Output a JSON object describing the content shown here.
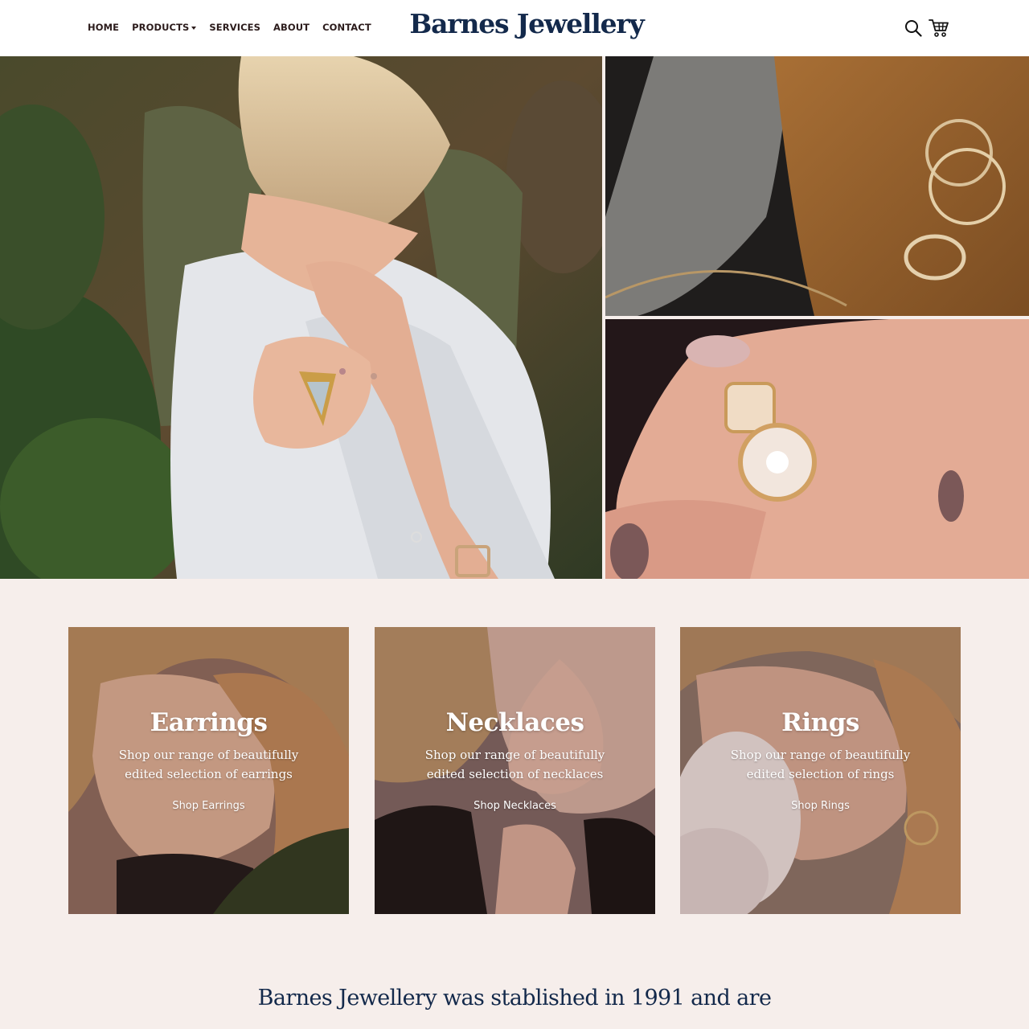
{
  "brand": {
    "name": "Barnes Jewellery",
    "color": "#13294b"
  },
  "nav": {
    "items": [
      {
        "label": "HOME"
      },
      {
        "label": "PRODUCTS"
      },
      {
        "label": "SERVICES"
      },
      {
        "label": "ABOUT"
      },
      {
        "label": "CONTACT"
      }
    ]
  },
  "header_icons": {
    "search": "search-icon",
    "cart": "cart-icon"
  },
  "hero": {
    "images": [
      "woman-wearing-rings-photo",
      "gold-rings-on-fabric-photo",
      "pearl-ring-on-hand-photo"
    ]
  },
  "categories": [
    {
      "title": "Earrings",
      "description": "Shop our range of beautifully edited selection of earrings",
      "link": "Shop Earrings"
    },
    {
      "title": "Necklaces",
      "description": "Shop our range of beautifully edited selection of necklaces",
      "link": "Shop Necklaces"
    },
    {
      "title": "Rings",
      "description": "Shop our range of beautifully edited selection of rings",
      "link": "Shop Rings"
    }
  ],
  "intro": {
    "text": "Barnes Jewellery was stablished in 1991 and are"
  },
  "colors": {
    "background": "#f6eeeb",
    "nav_text": "#2c1c1c",
    "heading": "#13294b"
  }
}
